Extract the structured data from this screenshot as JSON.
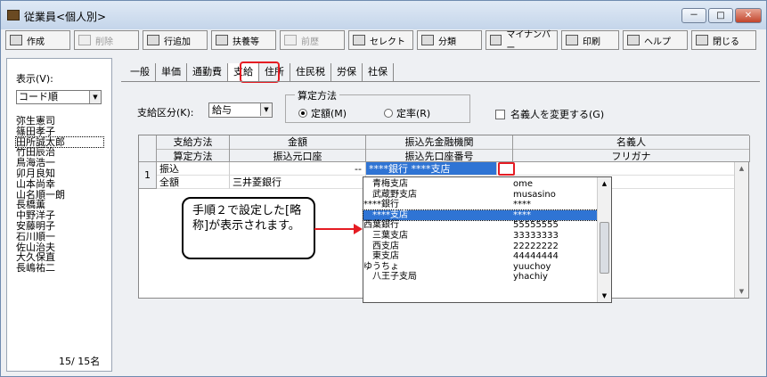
{
  "window": {
    "title": "従業員<個人別>",
    "minimize": "－",
    "maximize": "□",
    "close": "✕"
  },
  "toolbar": {
    "create": "作成",
    "delete": "削除",
    "add_row": "行追加",
    "dependents": "扶養等",
    "previous": "前歴",
    "select": "セレクト",
    "classify": "分類",
    "mynumber": "マイナンバー",
    "print": "印刷",
    "help": "ヘルプ",
    "close": "閉じる"
  },
  "left_panel": {
    "display_label": "表示(V):",
    "display_value": "コード順",
    "employees": [
      "弥生憲司",
      "篠田孝子",
      "田所誠太郎",
      "竹田辰治",
      "鳥海浩一",
      "卯月良知",
      "山本尚幸",
      "山名順一朗",
      "長橋薫",
      "中野洋子",
      "安藤明子",
      "石川順一",
      "佐山治夫",
      "大久保直",
      "長嶋祐二"
    ],
    "count": "15/ 15名"
  },
  "tabs": [
    "一般",
    "単価",
    "通勤費",
    "支給",
    "住所",
    "住民税",
    "労保",
    "社保"
  ],
  "active_tab": "支給",
  "form": {
    "kubun_label": "支給区分(K):",
    "kubun_value": "給与",
    "santei_legend": "算定方法",
    "radio_fixed": "定額(M)",
    "radio_rate": "定率(R)",
    "change_name": "名義人を変更する(G)"
  },
  "grid": {
    "headers": [
      [
        "支給方法",
        "算定方法"
      ],
      [
        "金額",
        "振込元口座"
      ],
      [
        "振込先金融機関",
        "振込先口座番号"
      ],
      [
        "名義人",
        "フリガナ"
      ]
    ],
    "row_num": "1",
    "method": "振込",
    "calc": "全額",
    "amount": "--",
    "source_bank": "三井菱銀行",
    "dest_bank": "****銀行 ****支店"
  },
  "dropdown": [
    {
      "branch": "　青梅支店",
      "code": "ome"
    },
    {
      "branch": "　武蔵野支店",
      "code": "musasino"
    },
    {
      "branch": "****銀行",
      "code": "****"
    },
    {
      "branch": "　****支店",
      "code": "****"
    },
    {
      "branch": "西葉銀行",
      "code": "55555555"
    },
    {
      "branch": "　三葉支店",
      "code": "33333333"
    },
    {
      "branch": "　西支店",
      "code": "22222222"
    },
    {
      "branch": "　東支店",
      "code": "44444444"
    },
    {
      "branch": "ゆうちょ",
      "code": "yuuchoy"
    },
    {
      "branch": "　八王子支局",
      "code": "yhachiy"
    }
  ],
  "dropdown_selected": "3",
  "callout": "手順２で設定した[略称]が表示されます。"
}
